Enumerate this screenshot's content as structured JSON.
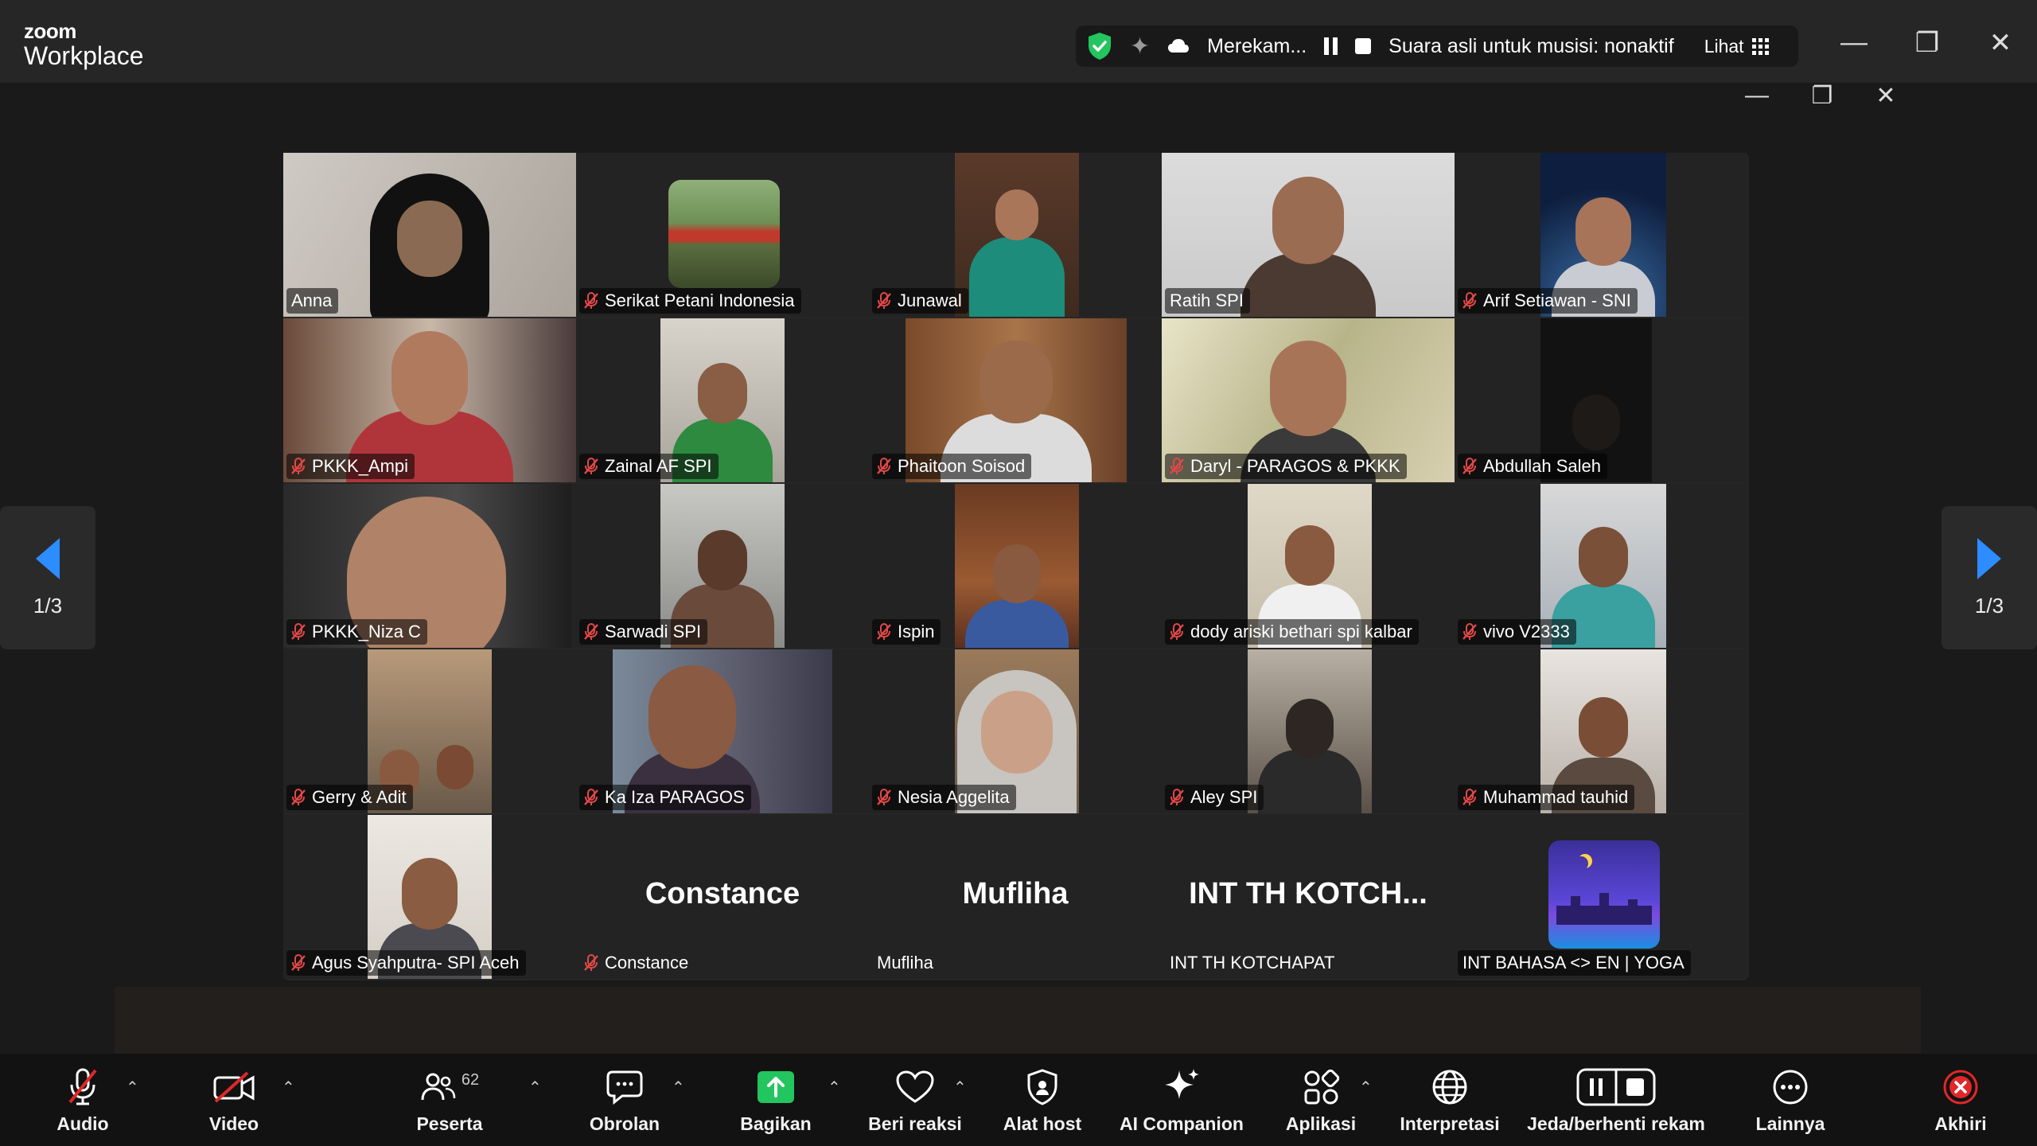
{
  "app": {
    "logo_top": "zoom",
    "logo_bottom": "Workplace"
  },
  "recording": {
    "status": "Merekam...",
    "original_sound": "Suara asli untuk musisi: nonaktif",
    "view_label": "Lihat"
  },
  "colors": {
    "active_speaker": "#23d46b",
    "nav_arrow": "#2d8cff",
    "end_button": "#e02828",
    "share_button": "#22c55e",
    "mute_icon": "#e34848"
  },
  "pagination": {
    "left": "1/3",
    "right": "1/3"
  },
  "participants": [
    {
      "name": "Anna",
      "muted": false
    },
    {
      "name": "Serikat Petani Indonesia",
      "muted": true
    },
    {
      "name": "Junawal",
      "muted": true
    },
    {
      "name": "Ratih SPI",
      "muted": false
    },
    {
      "name": "Arif Setiawan - SNI",
      "muted": true
    },
    {
      "name": "PKKK_Ampi",
      "muted": true
    },
    {
      "name": "Zainal AF SPI",
      "muted": true
    },
    {
      "name": "Phaitoon Soisod",
      "muted": true
    },
    {
      "name": "Daryl - PARAGOS & PKKK",
      "muted": true
    },
    {
      "name": "Abdullah Saleh",
      "muted": true
    },
    {
      "name": "PKKK_Niza C",
      "muted": true
    },
    {
      "name": "Sarwadi SPI",
      "muted": true
    },
    {
      "name": "Ispin",
      "muted": true
    },
    {
      "name": "dody ariski bethari spi kalbar",
      "muted": true
    },
    {
      "name": "vivo V2333",
      "muted": true
    },
    {
      "name": "Gerry & Adit",
      "muted": true
    },
    {
      "name": "Ka Iza PARAGOS",
      "muted": true
    },
    {
      "name": "Nesia Aggelita",
      "muted": true
    },
    {
      "name": "Aley SPI",
      "muted": true
    },
    {
      "name": "Muhammad tauhid",
      "muted": true
    },
    {
      "name": "Agus Syahputra- SPI Aceh",
      "muted": true
    },
    {
      "name": "Constance",
      "muted": true,
      "display": "Constance"
    },
    {
      "name": "Mufliha",
      "muted": false,
      "display": "Mufliha"
    },
    {
      "name": "INT TH KOTCHAPAT",
      "muted": false,
      "display": "INT TH KOTCH..."
    },
    {
      "name": "INT BAHASA <> EN | YOGA",
      "muted": false
    }
  ],
  "toolbar": {
    "audio": "Audio",
    "video": "Video",
    "participants": "Peserta",
    "participants_count": "62",
    "chat": "Obrolan",
    "share": "Bagikan",
    "react": "Beri reaksi",
    "host_tools": "Alat host",
    "ai_companion": "AI Companion",
    "apps": "Aplikasi",
    "interpretation": "Interpretasi",
    "pause_record": "Jeda/berhenti rekam",
    "more": "Lainnya",
    "end": "Akhiri"
  }
}
